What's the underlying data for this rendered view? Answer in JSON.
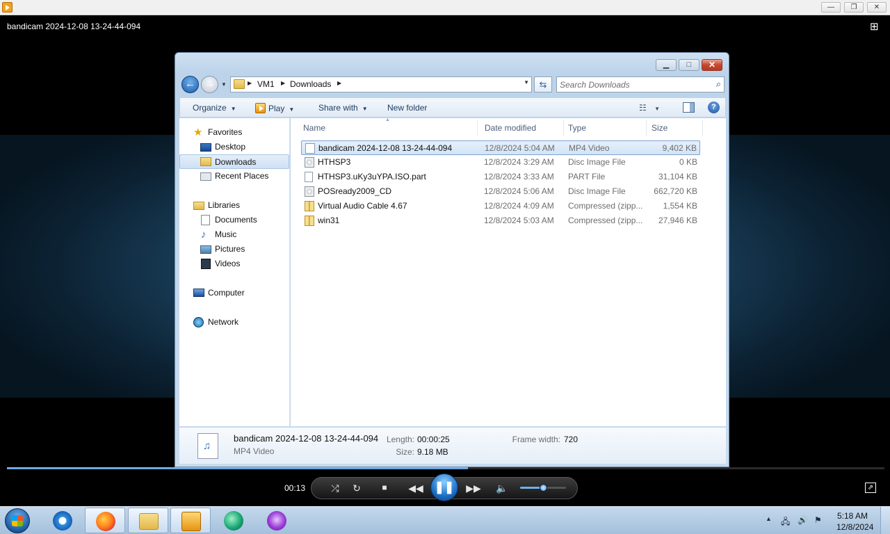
{
  "player": {
    "window_title": "",
    "video_title": "bandicam 2024-12-08 13-24-44-094",
    "time_elapsed": "00:13",
    "progress": 0.525,
    "volume": 0.5
  },
  "explorer": {
    "breadcrumb": [
      "VM1",
      "Downloads"
    ],
    "search_placeholder": "Search Downloads",
    "toolbar": {
      "organize": "Organize",
      "play": "Play",
      "share_with": "Share with",
      "new_folder": "New folder"
    },
    "nav": {
      "favorites": "Favorites",
      "desktop": "Desktop",
      "downloads": "Downloads",
      "recent_places": "Recent Places",
      "libraries": "Libraries",
      "documents": "Documents",
      "music": "Music",
      "pictures": "Pictures",
      "videos": "Videos",
      "computer": "Computer",
      "network": "Network"
    },
    "columns": {
      "name": "Name",
      "date_modified": "Date modified",
      "type": "Type",
      "size": "Size"
    },
    "files": [
      {
        "name": "bandicam 2024-12-08 13-24-44-094",
        "date": "12/8/2024 5:04 AM",
        "type": "MP4 Video",
        "size": "9,402 KB",
        "icon": "video-file-icon"
      },
      {
        "name": "HTHSP3",
        "date": "12/8/2024 3:29 AM",
        "type": "Disc Image File",
        "size": "0 KB",
        "icon": "disc-image-icon"
      },
      {
        "name": "HTHSP3.uKy3uYPA.ISO.part",
        "date": "12/8/2024 3:33 AM",
        "type": "PART File",
        "size": "31,104 KB",
        "icon": "blank-file-icon"
      },
      {
        "name": "POSready2009_CD",
        "date": "12/8/2024 5:06 AM",
        "type": "Disc Image File",
        "size": "662,720 KB",
        "icon": "disc-image-icon"
      },
      {
        "name": "Virtual Audio Cable 4.67",
        "date": "12/8/2024 4:09 AM",
        "type": "Compressed (zipp...",
        "size": "1,554 KB",
        "icon": "zip-folder-icon"
      },
      {
        "name": "win31",
        "date": "12/8/2024 5:03 AM",
        "type": "Compressed (zipp...",
        "size": "27,946 KB",
        "icon": "zip-folder-icon"
      }
    ],
    "details": {
      "name": "bandicam 2024-12-08 13-24-44-094",
      "type": "MP4 Video",
      "length_label": "Length:",
      "length": "00:00:25",
      "size_label": "Size:",
      "size": "9.18 MB",
      "frame_width_label": "Frame width:",
      "frame_width": "720"
    }
  },
  "taskbar": {
    "apps": [
      "internet-explorer",
      "firefox",
      "file-explorer",
      "media-player",
      "green-app",
      "purple-app"
    ],
    "time": "5:18 AM",
    "date": "12/8/2024"
  }
}
